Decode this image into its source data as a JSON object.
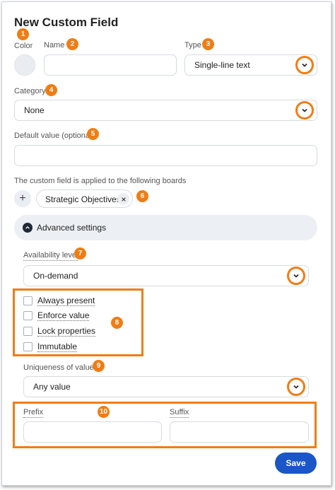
{
  "header": {
    "title": "New Custom Field"
  },
  "fields": {
    "color_label": "Color",
    "name_label": "Name",
    "name_value": "",
    "type_label": "Type",
    "type_value": "Single-line text",
    "category_label": "Category",
    "category_value": "None",
    "default_label": "Default value (optional)",
    "default_value": ""
  },
  "boards": {
    "label": "The custom field is applied to the following boards",
    "add_symbol": "+",
    "chips": [
      "Strategic Objectives"
    ]
  },
  "advanced": {
    "header_label": "Advanced settings",
    "availability_label": "Availability level",
    "availability_value": "On-demand",
    "checkboxes": [
      {
        "label": "Always present",
        "checked": false
      },
      {
        "label": "Enforce value",
        "checked": false
      },
      {
        "label": "Lock properties",
        "checked": false
      },
      {
        "label": "Immutable",
        "checked": false
      }
    ],
    "uniqueness_label": "Uniqueness of values",
    "uniqueness_value": "Any value",
    "prefix_label": "Prefix",
    "prefix_value": "",
    "suffix_label": "Suffix",
    "suffix_value": ""
  },
  "actions": {
    "save_label": "Save"
  },
  "callouts": [
    "1",
    "2",
    "3",
    "4",
    "5",
    "6",
    "7",
    "8",
    "9",
    "10"
  ],
  "colors": {
    "accent_orange": "#f07d14",
    "primary_blue": "#1a56c8",
    "color_swatch": "#e9ecf0"
  }
}
